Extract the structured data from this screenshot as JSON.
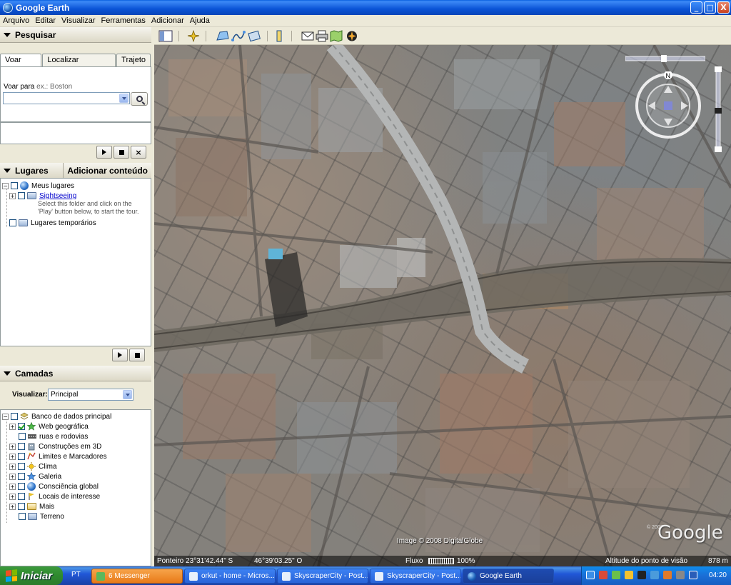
{
  "window": {
    "title": "Google Earth",
    "minimize": "_",
    "maximize": "□",
    "close": "X"
  },
  "menu": [
    "Arquivo",
    "Editar",
    "Visualizar",
    "Ferramentas",
    "Adicionar",
    "Ajuda"
  ],
  "search": {
    "header": "Pesquisar",
    "tabs": [
      "Voar para",
      "Localizar empresas",
      "Trajeto"
    ],
    "fly_label": "Voar para",
    "fly_example": "ex.: Boston",
    "fly_value": ""
  },
  "places": {
    "header": "Lugares",
    "add_content": "Adicionar conteúdo",
    "items": [
      {
        "label": "Meus lugares"
      },
      {
        "label": "Sightseeing"
      },
      {
        "label": "Lugares temporários"
      }
    ],
    "description": "Select this folder and click on the 'Play' button below, to start the tour."
  },
  "layers": {
    "header": "Camadas",
    "view_label": "Visualizar:",
    "view_value": "Principal",
    "items": [
      {
        "label": "Banco de dados principal",
        "icon": "database-icon"
      },
      {
        "label": "Web geográfica",
        "icon": "star-icon",
        "checked": true
      },
      {
        "label": "ruas e rodovias",
        "icon": "road-icon"
      },
      {
        "label": "Construções em 3D",
        "icon": "building-icon"
      },
      {
        "label": "Limites e Marcadores",
        "icon": "border-icon"
      },
      {
        "label": "Clima",
        "icon": "sun-icon"
      },
      {
        "label": "Galeria",
        "icon": "star-icon"
      },
      {
        "label": "Consciência global",
        "icon": "globe-icon"
      },
      {
        "label": "Locais de interesse",
        "icon": "flag-icon"
      },
      {
        "label": "Mais",
        "icon": "folder-icon"
      },
      {
        "label": "Terreno",
        "icon": "folder-icon"
      }
    ]
  },
  "map": {
    "attribution": "Image © 2008 DigitalGlobe",
    "watermark": "Google",
    "watermark_copy": "© 2007",
    "status": {
      "pointer": "Ponteiro 23°31'42.44\" S",
      "lon": "46°39'03.25\" O",
      "stream_label": "Fluxo",
      "stream_value": "100%",
      "altitude_label": "Altitude do ponto de visão",
      "altitude_value": "878 m"
    }
  },
  "taskbar": {
    "start": "Iniciar",
    "lang": "PT",
    "tasks": [
      {
        "label": "6 Messenger"
      },
      {
        "label": "orkut - home - Micros..."
      },
      {
        "label": "SkyscraperCity - Post..."
      },
      {
        "label": "SkyscraperCity - Post..."
      },
      {
        "label": "Google Earth"
      }
    ],
    "clock": "04:20"
  }
}
